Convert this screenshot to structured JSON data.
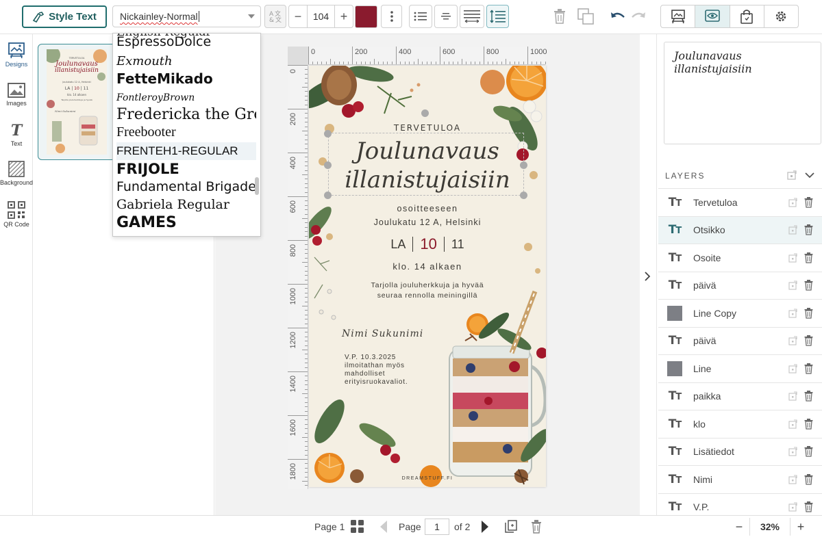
{
  "toolbar": {
    "style_text_label": "Style Text",
    "font_value": "Nickainley-Normal",
    "font_size": "104",
    "text_color": "#8a1b2e",
    "accent": "#1f6d6d"
  },
  "rail": {
    "items": [
      {
        "label": "Designs",
        "icon": "designs-icon"
      },
      {
        "label": "Images",
        "icon": "image-icon"
      },
      {
        "label": "Text",
        "icon": "text-icon"
      },
      {
        "label": "Background",
        "icon": "background-icon"
      },
      {
        "label": "QR Code",
        "icon": "qr-code-icon"
      }
    ]
  },
  "font_list": {
    "items": [
      {
        "label": "EspressoDolce",
        "family": "\"DejaVu Sans\", sans-serif",
        "size": 19,
        "weight": "normal",
        "style": "normal"
      },
      {
        "label": "Exmouth",
        "family": "\"DejaVu Serif\", serif",
        "size": 18,
        "weight": "normal",
        "style": "italic"
      },
      {
        "label": "FetteMikado",
        "family": "\"DejaVu Sans\", sans-serif",
        "size": 20,
        "weight": "bold",
        "style": "normal"
      },
      {
        "label": "FontleroyBrown",
        "family": "\"DejaVu Serif\", serif",
        "size": 14,
        "weight": "normal",
        "style": "italic"
      },
      {
        "label": "Fredericka the Great",
        "family": "\"DejaVu Serif\", serif",
        "size": 22,
        "weight": "normal",
        "style": "normal"
      },
      {
        "label": "Freebooter",
        "family": "\"Liberation Serif\", serif",
        "size": 20,
        "weight": "normal",
        "style": "normal"
      },
      {
        "label": "FRENTEH1-REGULAR",
        "family": "\"Liberation Sans\", sans-serif",
        "size": 17,
        "weight": "normal",
        "style": "normal"
      },
      {
        "label": "FRIJOLE",
        "family": "\"DejaVu Sans\", sans-serif",
        "size": 21,
        "weight": "bold",
        "style": "normal"
      },
      {
        "label": "Fundamental  Brigade",
        "family": "\"DejaVu Sans\", sans-serif",
        "size": 19,
        "weight": "normal",
        "style": "normal"
      },
      {
        "label": "Gabriela Regular",
        "family": "\"DejaVu Serif\", serif",
        "size": 19,
        "weight": "normal",
        "style": "normal"
      },
      {
        "label": "GAMES",
        "family": "\"DejaVu Sans\", sans-serif",
        "size": 22,
        "weight": "bold",
        "style": "normal"
      }
    ],
    "highlighted": "FRENTEH1-REGULAR"
  },
  "ruler": {
    "h": [
      "0",
      "200",
      "400",
      "600",
      "800",
      "1000"
    ],
    "v": [
      "0",
      "200",
      "400",
      "600",
      "800",
      "1000",
      "1200",
      "1400",
      "1600",
      "1800"
    ]
  },
  "design": {
    "welcome": "TERVETULOA",
    "title_line1": "Joulunavaus",
    "title_line2": "illanistujaisiin",
    "addr1": "osoitteeseen",
    "addr2": "Joulukatu 12 A, Helsinki",
    "weekday": "LA",
    "day": "10",
    "month": "11",
    "time": "klo. 14 alkaen",
    "extra1": "Tarjolla jouluherkkuja ja hyvää",
    "extra2": "seuraa rennolla meiningillä",
    "name": "Nimi Sukunimi",
    "vp1": "V.P. 10.3.2025",
    "vp2": "ilmoitathan myös",
    "vp3": "mahdolliset",
    "vp4": "erityisruokavaliot.",
    "brand": "DREAMSTUFF.FI",
    "title_color": "#8b1a2b",
    "bg_color": "#f4efe3"
  },
  "preview_text": "Joulunavaus illanistujaisiin",
  "layers": {
    "header": "LAYERS",
    "items": [
      {
        "name": "Tervetuloa",
        "kind": "text"
      },
      {
        "name": "Otsikko",
        "kind": "text",
        "active": true
      },
      {
        "name": "Osoite",
        "kind": "text"
      },
      {
        "name": "päivä",
        "kind": "text"
      },
      {
        "name": "Line Copy",
        "kind": "image"
      },
      {
        "name": "päivä",
        "kind": "text"
      },
      {
        "name": "Line",
        "kind": "image"
      },
      {
        "name": "paikka",
        "kind": "text"
      },
      {
        "name": "klo",
        "kind": "text"
      },
      {
        "name": "Lisätiedot",
        "kind": "text"
      },
      {
        "name": "Nimi",
        "kind": "text"
      },
      {
        "name": "V.P.",
        "kind": "text"
      }
    ]
  },
  "bottom": {
    "page_label": "Page 1",
    "page_word": "Page",
    "current_page": "1",
    "of_pages": "of 2",
    "zoom": "32%"
  }
}
